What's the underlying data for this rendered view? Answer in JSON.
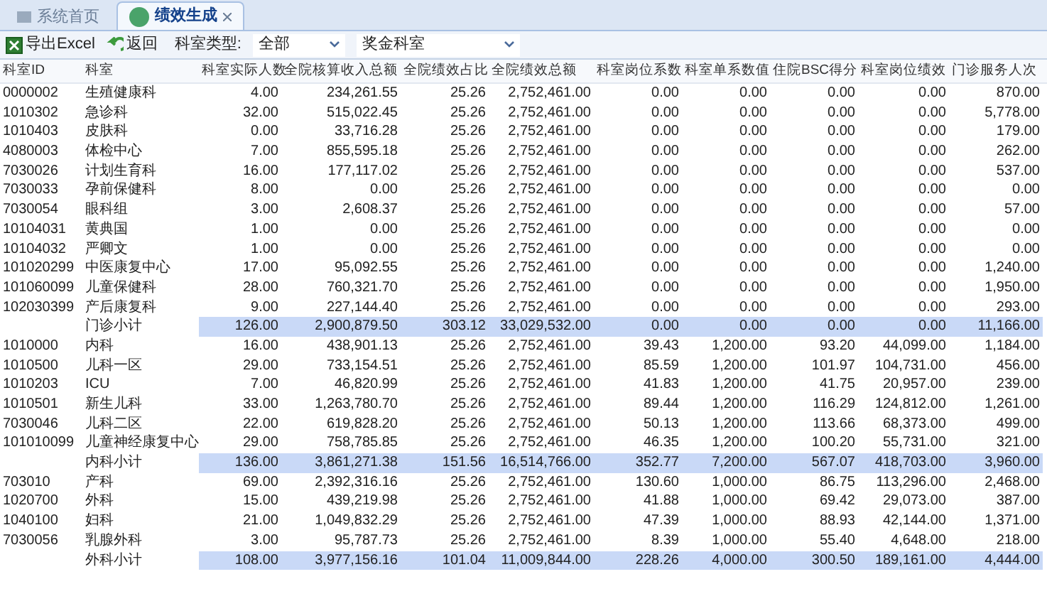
{
  "tabs": [
    {
      "label": "系统首页",
      "selected": false,
      "closable": false
    },
    {
      "label": "绩效生成",
      "selected": true,
      "closable": true
    }
  ],
  "toolbar": {
    "buttons": [
      {
        "label": "导出Excel",
        "kind": "excel"
      },
      {
        "label": "返回",
        "kind": "back"
      }
    ],
    "filter_label": "科室类型:",
    "selects": [
      {
        "value": "全部"
      },
      {
        "value": "奖金科室"
      }
    ]
  },
  "table": {
    "columns": [
      "科室ID",
      "科室",
      "科室实际人数",
      "全院核算收入总额",
      "全院绩效占比",
      "全院绩效总额",
      "科室岗位系数",
      "科室单系数值",
      "住院BSC得分",
      "科室岗位绩效",
      "门诊服务人次"
    ],
    "rows": [
      {
        "kind": "data",
        "cells": [
          "0000002",
          "生殖健康科",
          "4.00",
          "234,261.55",
          "25.26",
          "2,752,461.00",
          "0.00",
          "0.00",
          "0.00",
          "0.00",
          "870.00"
        ]
      },
      {
        "kind": "data",
        "cells": [
          "1010302",
          "急诊科",
          "32.00",
          "515,022.45",
          "25.26",
          "2,752,461.00",
          "0.00",
          "0.00",
          "0.00",
          "0.00",
          "5,778.00"
        ]
      },
      {
        "kind": "data",
        "cells": [
          "1010403",
          "皮肤科",
          "0.00",
          "33,716.28",
          "25.26",
          "2,752,461.00",
          "0.00",
          "0.00",
          "0.00",
          "0.00",
          "179.00"
        ]
      },
      {
        "kind": "data",
        "cells": [
          "4080003",
          "体检中心",
          "7.00",
          "855,595.18",
          "25.26",
          "2,752,461.00",
          "0.00",
          "0.00",
          "0.00",
          "0.00",
          "262.00"
        ]
      },
      {
        "kind": "data",
        "cells": [
          "7030026",
          "计划生育科",
          "16.00",
          "177,117.02",
          "25.26",
          "2,752,461.00",
          "0.00",
          "0.00",
          "0.00",
          "0.00",
          "537.00"
        ]
      },
      {
        "kind": "data",
        "cells": [
          "7030033",
          "孕前保健科",
          "8.00",
          "0.00",
          "25.26",
          "2,752,461.00",
          "0.00",
          "0.00",
          "0.00",
          "0.00",
          "0.00"
        ]
      },
      {
        "kind": "data",
        "cells": [
          "7030054",
          "眼科组",
          "3.00",
          "2,608.37",
          "25.26",
          "2,752,461.00",
          "0.00",
          "0.00",
          "0.00",
          "0.00",
          "57.00"
        ]
      },
      {
        "kind": "data",
        "cells": [
          "10104031",
          "黄典国",
          "1.00",
          "0.00",
          "25.26",
          "2,752,461.00",
          "0.00",
          "0.00",
          "0.00",
          "0.00",
          "0.00"
        ]
      },
      {
        "kind": "data",
        "cells": [
          "10104032",
          "严卿文",
          "1.00",
          "0.00",
          "25.26",
          "2,752,461.00",
          "0.00",
          "0.00",
          "0.00",
          "0.00",
          "0.00"
        ]
      },
      {
        "kind": "data",
        "cells": [
          "101020299",
          "中医康复中心",
          "17.00",
          "95,092.55",
          "25.26",
          "2,752,461.00",
          "0.00",
          "0.00",
          "0.00",
          "0.00",
          "1,240.00"
        ]
      },
      {
        "kind": "data",
        "cells": [
          "101060099",
          "儿童保健科",
          "28.00",
          "760,321.70",
          "25.26",
          "2,752,461.00",
          "0.00",
          "0.00",
          "0.00",
          "0.00",
          "1,950.00"
        ]
      },
      {
        "kind": "data",
        "cells": [
          "102030399",
          "产后康复科",
          "9.00",
          "227,144.40",
          "25.26",
          "2,752,461.00",
          "0.00",
          "0.00",
          "0.00",
          "0.00",
          "293.00"
        ]
      },
      {
        "kind": "subtotal",
        "cells": [
          "",
          "门诊小计",
          "126.00",
          "2,900,879.50",
          "303.12",
          "33,029,532.00",
          "0.00",
          "0.00",
          "0.00",
          "0.00",
          "11,166.00"
        ]
      },
      {
        "kind": "data",
        "cells": [
          "1010000",
          "内科",
          "16.00",
          "438,901.13",
          "25.26",
          "2,752,461.00",
          "39.43",
          "1,200.00",
          "93.20",
          "44,099.00",
          "1,184.00"
        ]
      },
      {
        "kind": "data",
        "cells": [
          "1010500",
          "儿科一区",
          "29.00",
          "733,154.51",
          "25.26",
          "2,752,461.00",
          "85.59",
          "1,200.00",
          "101.97",
          "104,731.00",
          "456.00"
        ]
      },
      {
        "kind": "data",
        "cells": [
          "1010203",
          "ICU",
          "7.00",
          "46,820.99",
          "25.26",
          "2,752,461.00",
          "41.83",
          "1,200.00",
          "41.75",
          "20,957.00",
          "239.00"
        ]
      },
      {
        "kind": "data",
        "cells": [
          "1010501",
          "新生儿科",
          "33.00",
          "1,263,780.70",
          "25.26",
          "2,752,461.00",
          "89.44",
          "1,200.00",
          "116.29",
          "124,812.00",
          "1,261.00"
        ]
      },
      {
        "kind": "data",
        "cells": [
          "7030046",
          "儿科二区",
          "22.00",
          "619,828.20",
          "25.26",
          "2,752,461.00",
          "50.13",
          "1,200.00",
          "113.66",
          "68,373.00",
          "499.00"
        ]
      },
      {
        "kind": "data",
        "cells": [
          "101010099",
          "儿童神经康复中心",
          "29.00",
          "758,785.85",
          "25.26",
          "2,752,461.00",
          "46.35",
          "1,200.00",
          "100.20",
          "55,731.00",
          "321.00"
        ]
      },
      {
        "kind": "subtotal",
        "cells": [
          "",
          "内科小计",
          "136.00",
          "3,861,271.38",
          "151.56",
          "16,514,766.00",
          "352.77",
          "7,200.00",
          "567.07",
          "418,703.00",
          "3,960.00"
        ]
      },
      {
        "kind": "data",
        "cells": [
          "703010",
          "产科",
          "69.00",
          "2,392,316.16",
          "25.26",
          "2,752,461.00",
          "130.60",
          "1,000.00",
          "86.75",
          "113,296.00",
          "2,468.00"
        ]
      },
      {
        "kind": "data",
        "cells": [
          "1020700",
          "外科",
          "15.00",
          "439,219.98",
          "25.26",
          "2,752,461.00",
          "41.88",
          "1,000.00",
          "69.42",
          "29,073.00",
          "387.00"
        ]
      },
      {
        "kind": "data",
        "cells": [
          "1040100",
          "妇科",
          "21.00",
          "1,049,832.29",
          "25.26",
          "2,752,461.00",
          "47.39",
          "1,000.00",
          "88.93",
          "42,144.00",
          "1,371.00"
        ]
      },
      {
        "kind": "data",
        "cells": [
          "7030056",
          "乳腺外科",
          "3.00",
          "95,787.73",
          "25.26",
          "2,752,461.00",
          "8.39",
          "1,000.00",
          "55.40",
          "4,648.00",
          "218.00"
        ]
      },
      {
        "kind": "subtotal",
        "cells": [
          "",
          "外科小计",
          "108.00",
          "3,977,156.16",
          "101.04",
          "11,009,844.00",
          "228.26",
          "4,000.00",
          "300.50",
          "189,161.00",
          "4,444.00"
        ]
      }
    ]
  }
}
